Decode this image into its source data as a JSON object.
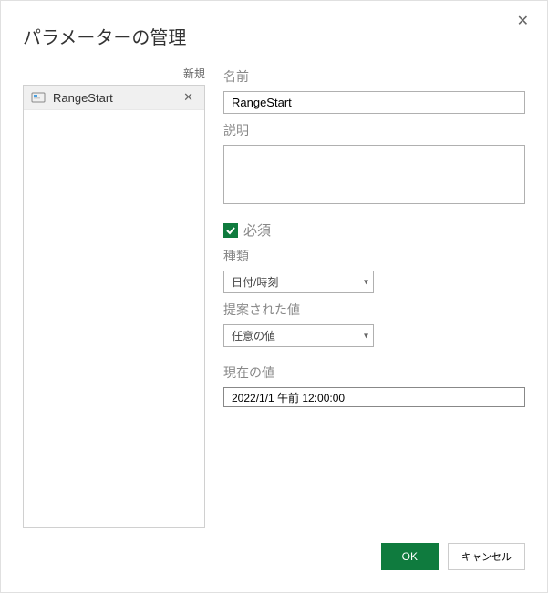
{
  "dialog": {
    "title": "パラメーターの管理"
  },
  "left": {
    "new_label": "新規",
    "items": [
      {
        "name": "RangeStart"
      }
    ]
  },
  "form": {
    "name_label": "名前",
    "name_value": "RangeStart",
    "description_label": "説明",
    "description_value": "",
    "required_label": "必須",
    "required_checked": true,
    "type_label": "種類",
    "type_value": "日付/時刻",
    "suggested_label": "提案された値",
    "suggested_value": "任意の値",
    "current_label": "現在の値",
    "current_value": "2022/1/1 午前 12:00:00"
  },
  "footer": {
    "ok": "OK",
    "cancel": "キャンセル"
  }
}
